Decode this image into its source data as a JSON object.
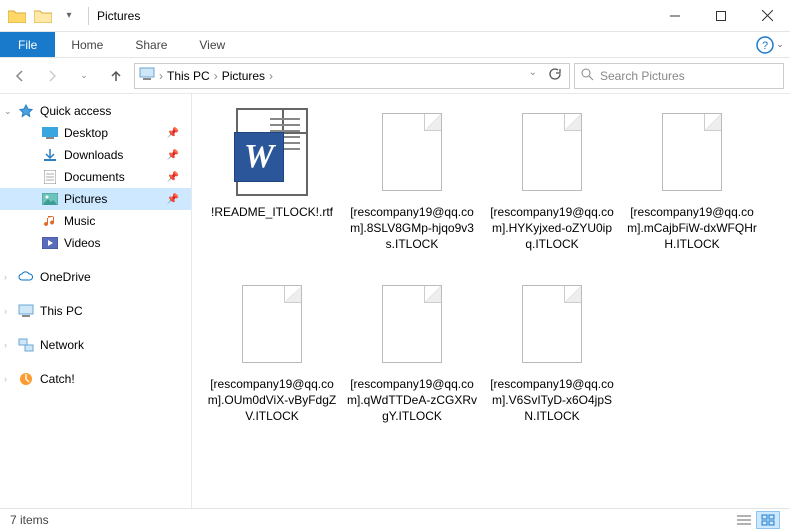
{
  "title": "Pictures",
  "ribbon": {
    "file": "File",
    "tabs": [
      "Home",
      "Share",
      "View"
    ]
  },
  "breadcrumb": {
    "root": "This PC",
    "folder": "Pictures"
  },
  "search": {
    "placeholder": "Search Pictures"
  },
  "sidebar": {
    "quick_access": "Quick access",
    "children": [
      {
        "label": "Desktop",
        "pinned": true
      },
      {
        "label": "Downloads",
        "pinned": true
      },
      {
        "label": "Documents",
        "pinned": true
      },
      {
        "label": "Pictures",
        "pinned": true,
        "selected": true
      },
      {
        "label": "Music",
        "pinned": false
      },
      {
        "label": "Videos",
        "pinned": false
      }
    ],
    "onedrive": "OneDrive",
    "thispc": "This PC",
    "network": "Network",
    "catch": "Catch!"
  },
  "files": [
    {
      "name": "!README_ITLOCK!.rtf",
      "type": "word"
    },
    {
      "name": "[rescompany19@qq.com].8SLV8GMp-hjqo9v3s.ITLOCK",
      "type": "blank"
    },
    {
      "name": "[rescompany19@qq.com].HYKyjxed-oZYU0ipq.ITLOCK",
      "type": "blank"
    },
    {
      "name": "[rescompany19@qq.com].mCajbFiW-dxWFQHrH.ITLOCK",
      "type": "blank"
    },
    {
      "name": "[rescompany19@qq.com].OUm0dViX-vByFdgZV.ITLOCK",
      "type": "blank"
    },
    {
      "name": "[rescompany19@qq.com].qWdTTDeA-zCGXRvgY.ITLOCK",
      "type": "blank"
    },
    {
      "name": "[rescompany19@qq.com].V6SvITyD-x6O4jpSN.ITLOCK",
      "type": "blank"
    }
  ],
  "status": {
    "count": "7 items"
  }
}
